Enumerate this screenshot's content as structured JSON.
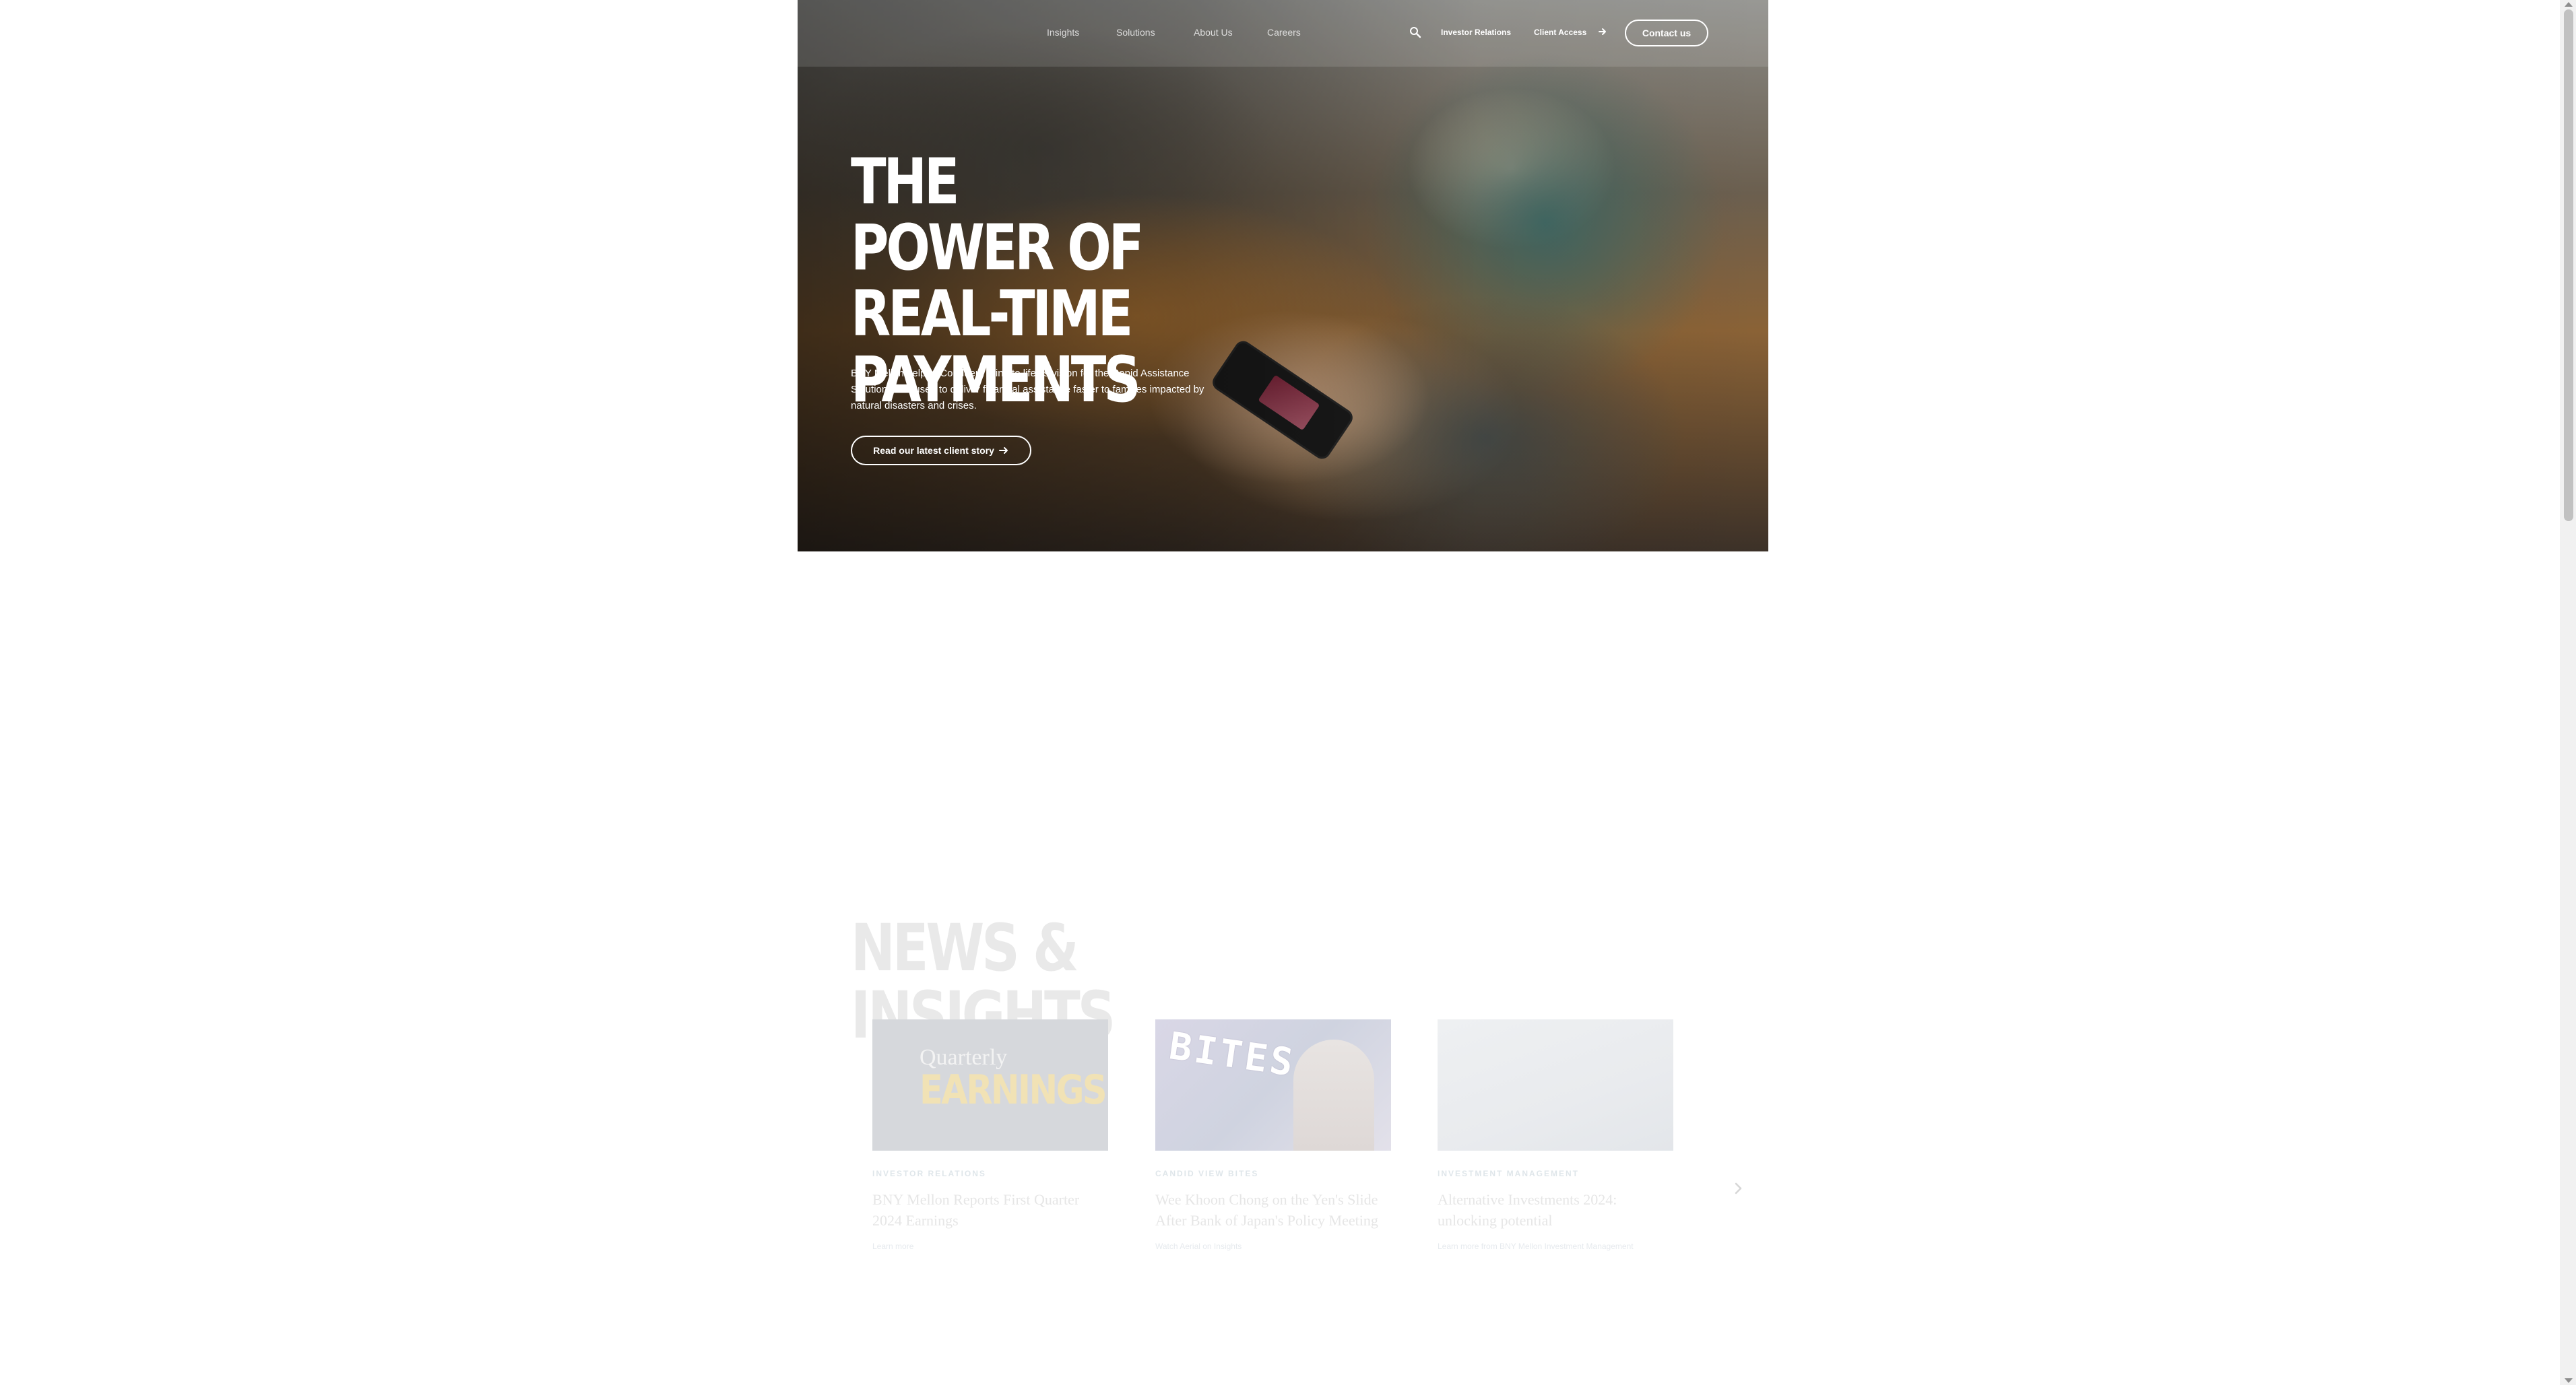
{
  "nav": {
    "links": [
      "Insights",
      "Solutions",
      "About Us",
      "Careers"
    ],
    "investor_relations": "Investor Relations",
    "client_access": "Client Access",
    "contact": "Contact us"
  },
  "hero": {
    "title": "THE POWER OF REAL-TIME PAYMENTS",
    "description": "BNY Mellon helped Conduent bring to life its vision for the Rapid Assistance Solution, now used to deliver financial assistance faster to families impacted by natural disasters and crises.",
    "cta": "Read our latest client story"
  },
  "news": {
    "heading": "NEWS & INSIGHTS",
    "cards": [
      {
        "image_text_1": "Quarterly",
        "image_text_2": "EARNINGS",
        "tag": "INVESTOR RELATIONS",
        "title": "BNY Mellon Reports First Quarter 2024 Earnings",
        "link": "Learn more"
      },
      {
        "image_text_1": "BITES",
        "tag": "CANDID VIEW BITES",
        "title": "Wee Khoon Chong on the Yen's Slide After Bank of Japan's Policy Meeting",
        "link": "Watch Aerial on Insights"
      },
      {
        "tag": "INVESTMENT MANAGEMENT",
        "title": "Alternative Investments 2024: unlocking potential",
        "link": "Learn more from BNY Mellon Investment Management"
      }
    ]
  },
  "colors": {
    "hero_overlay": "#000000",
    "text_on_hero": "#ffffff",
    "faded_text": "#e6e6e6"
  }
}
